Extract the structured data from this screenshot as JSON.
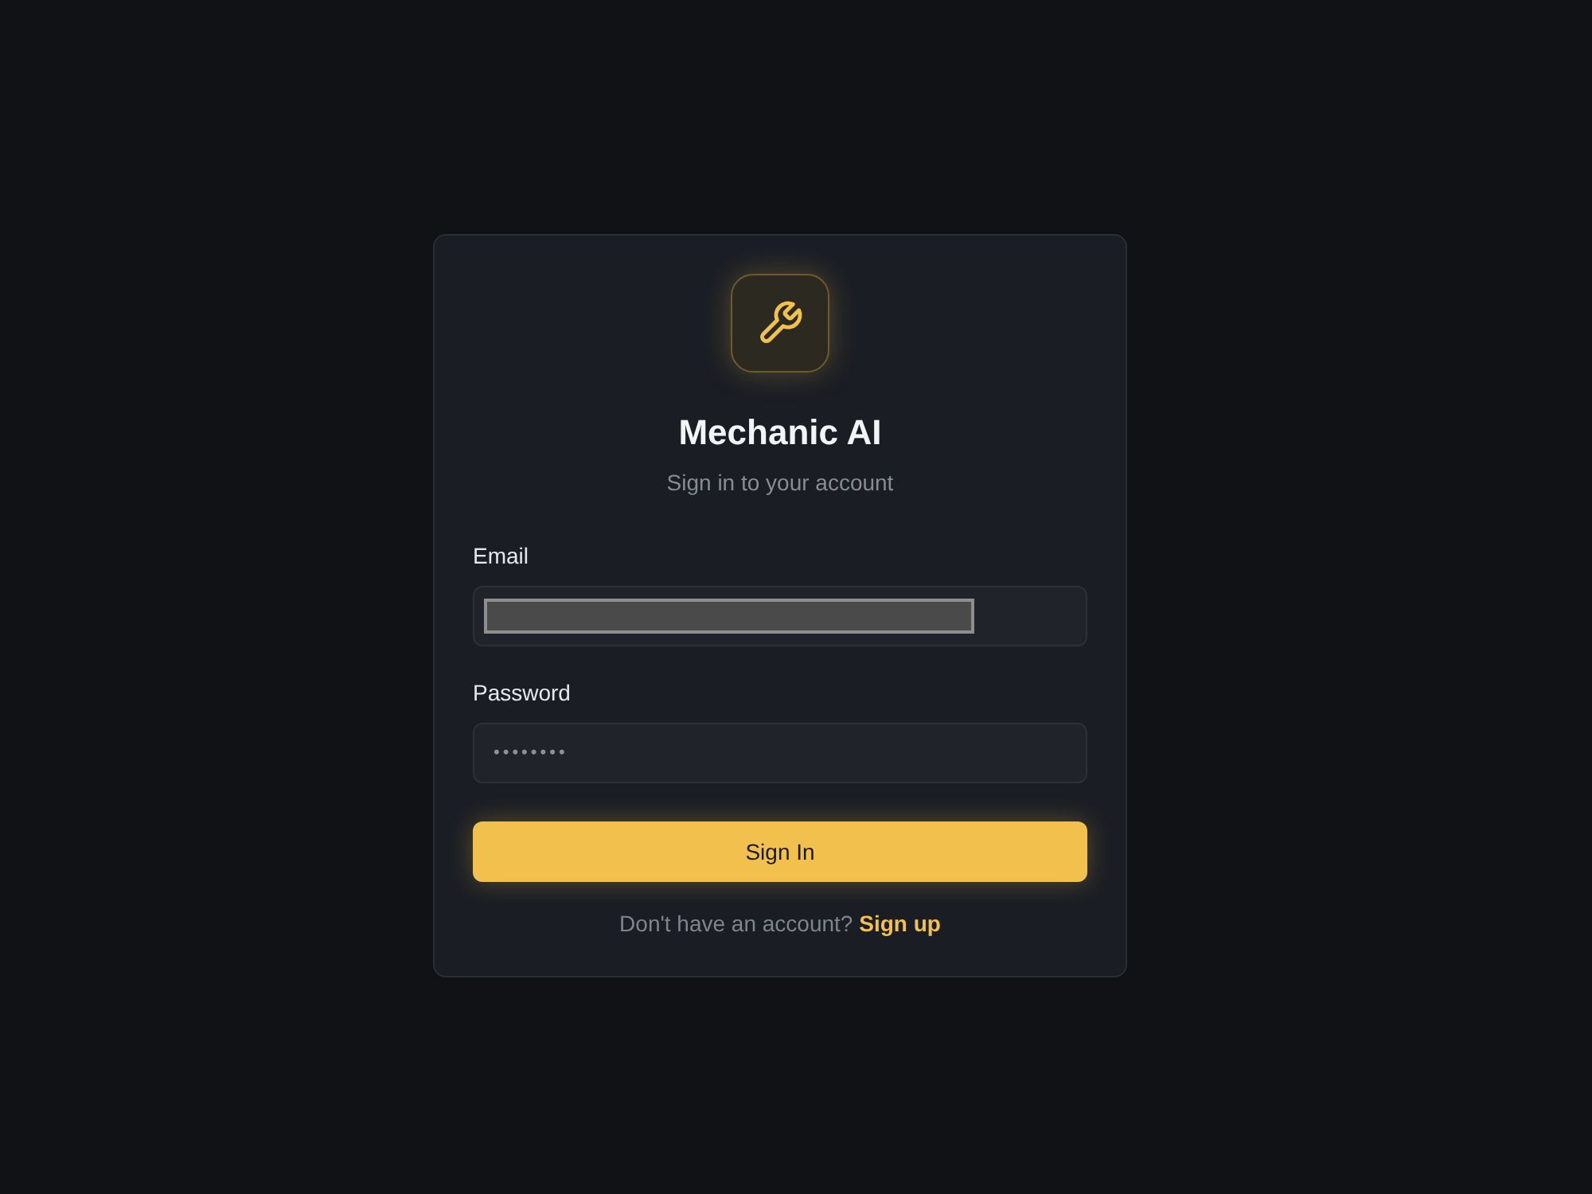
{
  "header": {
    "title": "Mechanic AI",
    "subtitle": "Sign in to your account"
  },
  "fields": [
    {
      "kind": "email",
      "label": "Email",
      "redacted": true
    },
    {
      "kind": "password",
      "label": "Password",
      "value": "••••••••"
    }
  ],
  "submit": {
    "label": "Sign In"
  },
  "footer": {
    "text": "Don't have an account?",
    "link": "Sign up"
  }
}
